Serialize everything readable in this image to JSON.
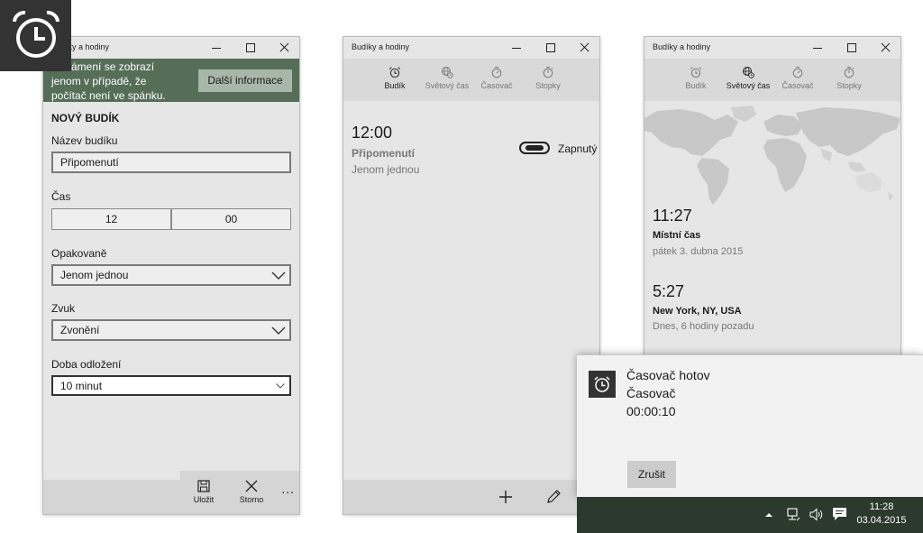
{
  "app_logo": {
    "icon": "alarm-clock-icon"
  },
  "window1": {
    "title": "Budíky a hodiny",
    "banner": {
      "text_lines": [
        "Oznámení se zobrazí",
        "jenom v případě, že",
        "počítač není ve spánku."
      ],
      "more_info_label": "Další informace"
    },
    "heading": "NOVÝ BUDÍK",
    "name_label": "Název budíku",
    "name_value": "Připomenutí",
    "time_label": "Čas",
    "hour": "12",
    "minute": "00",
    "repeat_label": "Opakovaně",
    "repeat_value": "Jenom jednou",
    "sound_label": "Zvuk",
    "sound_value": "Zvonění",
    "snooze_label": "Doba odložení",
    "snooze_value": "10 minut",
    "save_label": "Uložit",
    "cancel_label": "Storno",
    "more_label": "..."
  },
  "window2": {
    "title": "Budíky a hodiny",
    "tabs": [
      {
        "label": "Budík",
        "icon": "alarm-icon",
        "active": true
      },
      {
        "label": "Světový čas",
        "icon": "globe-icon",
        "active": false
      },
      {
        "label": "Časovač",
        "icon": "timer-icon",
        "active": false
      },
      {
        "label": "Stopky",
        "icon": "stopwatch-icon",
        "active": false
      }
    ],
    "alarm": {
      "time": "12:00",
      "name": "Připomenutí",
      "repeat": "Jenom jednou",
      "toggle_label": "Zapnutý",
      "enabled": true
    }
  },
  "window3": {
    "title": "Budíky a hodiny",
    "tabs": [
      {
        "label": "Budík",
        "icon": "alarm-icon",
        "active": false
      },
      {
        "label": "Světový čas",
        "icon": "globe-icon",
        "active": true
      },
      {
        "label": "Časovač",
        "icon": "timer-icon",
        "active": false
      },
      {
        "label": "Stopky",
        "icon": "stopwatch-icon",
        "active": false
      }
    ],
    "clocks": [
      {
        "time": "11:27",
        "name": "Místní čas",
        "sub": "pátek 3. dubna 2015"
      },
      {
        "time": "5:27",
        "name": "New York, NY, USA",
        "sub": "Dnes, 6 hodiny pozadu"
      }
    ]
  },
  "toast": {
    "title": "Časovač hotov",
    "line2": "Časovač",
    "line3": "00:00:10",
    "dismiss_label": "Zrušit"
  },
  "taskbar": {
    "time": "11:28",
    "date": "03.04.2015"
  },
  "colors": {
    "banner": "#566d58",
    "taskbar": "#2b3a2d",
    "logo_bg": "#333333"
  }
}
